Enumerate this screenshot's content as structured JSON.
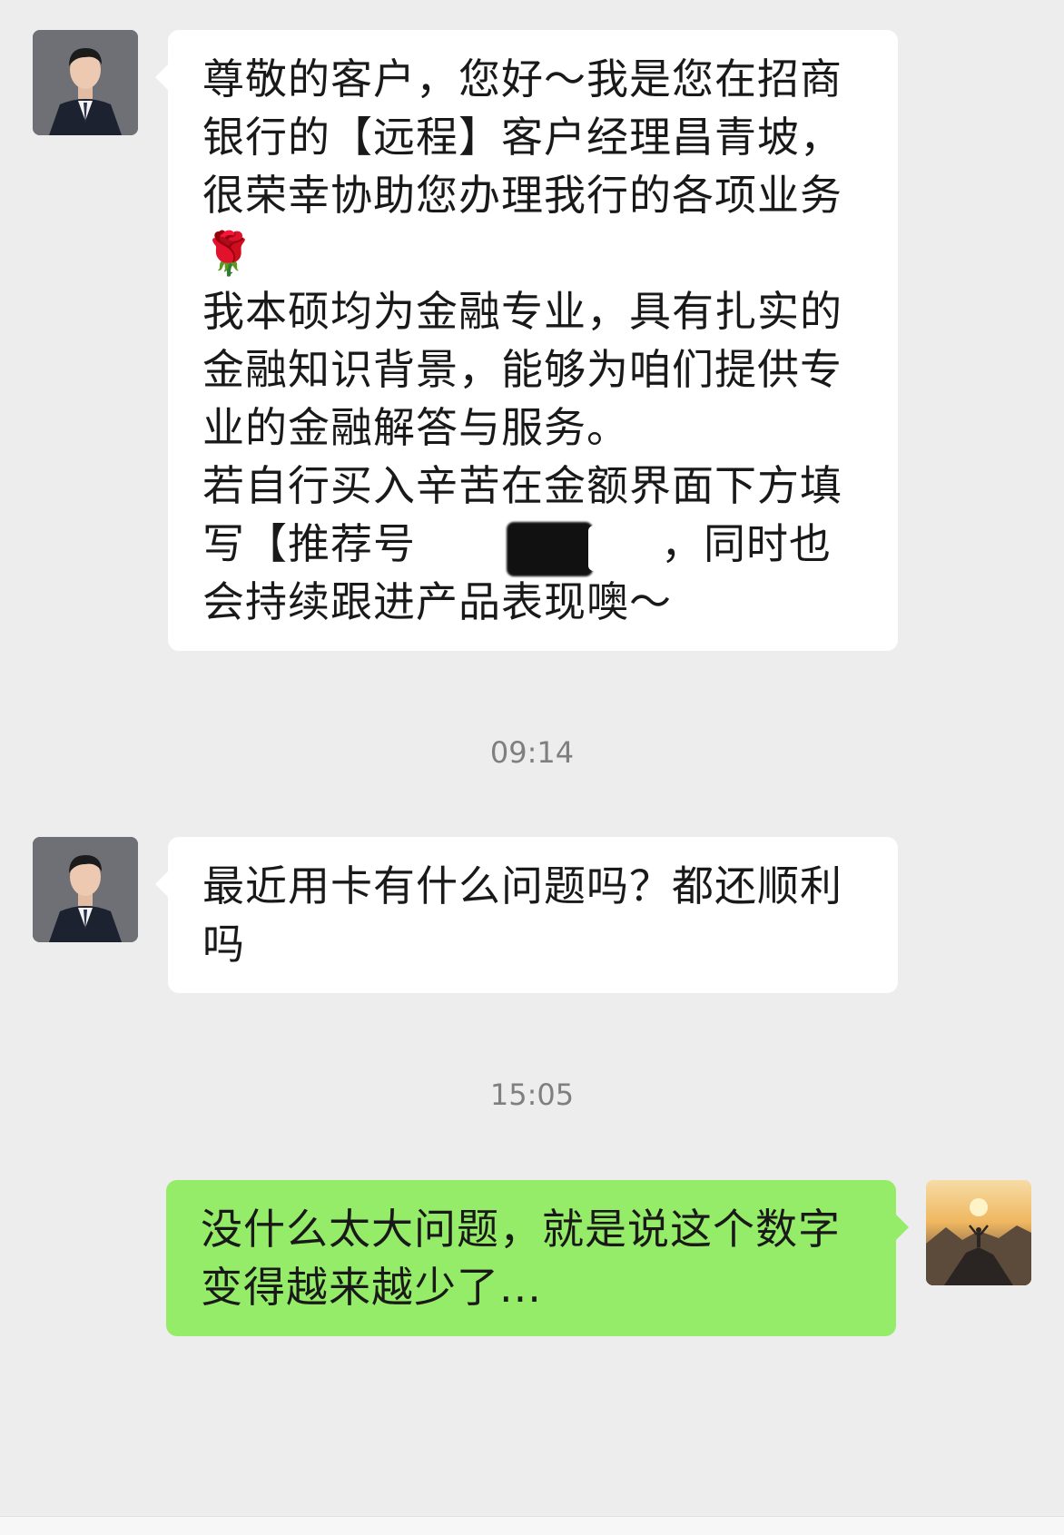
{
  "messages": [
    {
      "sender": "agent",
      "lines": [
        "尊敬的客户，您好～我是您在招商",
        "银行的【远程】客户经理昌青坡，",
        "很荣幸协助您办理我行的各项业务",
        "🌹",
        "我本硕均为金融专业，具有扎实的",
        "金融知识背景，能够为咱们提供专",
        "业的金融解答与服务。",
        "若自行买入辛苦在金额界面下方填"
      ],
      "line9_prefix": "写【推荐号",
      "line9_suffix": "，同时也",
      "line10": "会持续跟进产品表现噢～"
    },
    {
      "sender": "agent",
      "lines": [
        "最近用卡有什么问题吗？都还顺利",
        "吗"
      ]
    },
    {
      "sender": "me",
      "lines": [
        "没什么太大问题，就是说这个数字",
        "变得越来越少了..."
      ]
    }
  ],
  "timestamps": [
    "09:14",
    "15:05"
  ],
  "colors": {
    "background": "#ededed",
    "incoming_bubble": "#ffffff",
    "outgoing_bubble": "#95ec69",
    "text": "#191919",
    "timestamp": "#7f7f7f"
  }
}
